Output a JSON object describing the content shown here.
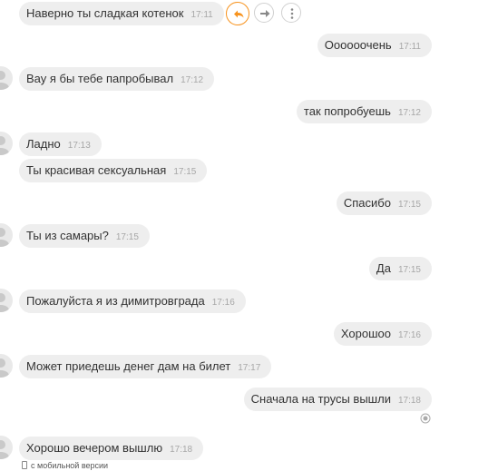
{
  "chat": {
    "messages": [
      {
        "dir": "in",
        "text": "Наверно ты сладкая котенок",
        "time": "17:11"
      },
      {
        "dir": "out",
        "text": "Оооооочень",
        "time": "17:11"
      },
      {
        "dir": "in",
        "text": "Вау я бы тебе папробывал",
        "time": "17:12"
      },
      {
        "dir": "out",
        "text": "так попробуешь",
        "time": "17:12"
      },
      {
        "dir": "in",
        "text": "Ладно",
        "time": "17:13"
      },
      {
        "dir": "in",
        "text": "Ты красивая сексуальная",
        "time": "17:15"
      },
      {
        "dir": "out",
        "text": "Спасибо",
        "time": "17:15"
      },
      {
        "dir": "in",
        "text": "Ты из самары?",
        "time": "17:15"
      },
      {
        "dir": "out",
        "text": "Да",
        "time": "17:15"
      },
      {
        "dir": "in",
        "text": "Пожалуйста я из димитровграда",
        "time": "17:16"
      },
      {
        "dir": "out",
        "text": "Хорошоо",
        "time": "17:16"
      },
      {
        "dir": "in",
        "text": "Может приедешь денег дам на билет",
        "time": "17:17"
      },
      {
        "dir": "out",
        "text": "Сначала на трусы вышли",
        "time": "17:18"
      },
      {
        "dir": "in",
        "text": "Хорошо вечером вышлю",
        "time": "17:18"
      }
    ],
    "mobile_note": "с мобильной версии"
  },
  "icons": {
    "reply": "reply-arrow-icon",
    "forward": "forward-arrow-icon",
    "more": "more-vertical-icon",
    "status": "read-status-icon",
    "mobile": "mobile-phone-icon"
  },
  "colors": {
    "accent": "#f7931e",
    "bubble": "#eeeeee",
    "time": "#a7a7a7"
  }
}
